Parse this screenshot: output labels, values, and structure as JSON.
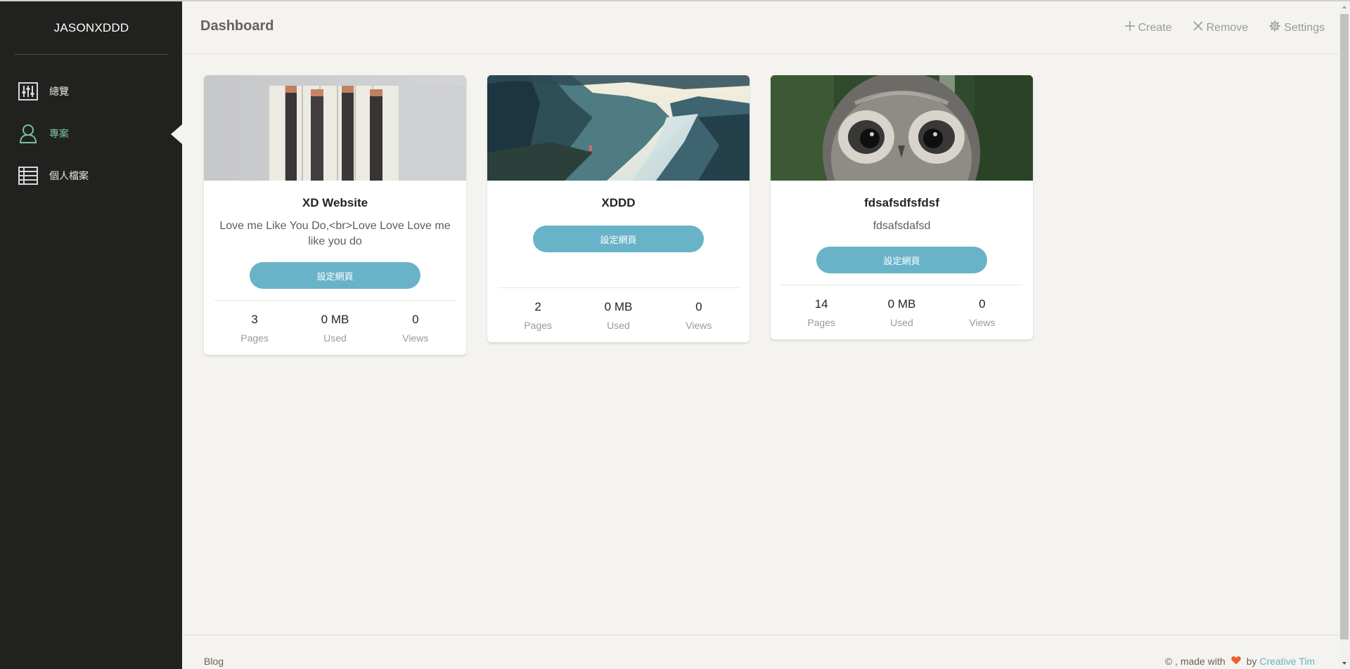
{
  "sidebar": {
    "brand": "JASONXDDD",
    "items": [
      {
        "label": "總覽",
        "icon": "sliders-icon"
      },
      {
        "label": "專案",
        "icon": "user-icon",
        "active": true
      },
      {
        "label": "個人檔案",
        "icon": "list-icon"
      }
    ]
  },
  "header": {
    "title": "Dashboard",
    "actions": {
      "create": "Create",
      "remove": "Remove",
      "settings": "Settings"
    }
  },
  "cards": [
    {
      "title": "XD Website",
      "description": "Love me Like You Do,<br>Love Love Love me like you do",
      "button": "設定網頁",
      "stats": [
        {
          "value": "3",
          "label": "Pages"
        },
        {
          "value": "0 MB",
          "label": "Used"
        },
        {
          "value": "0",
          "label": "Views"
        }
      ]
    },
    {
      "title": "XDDD",
      "description": "",
      "button": "設定網頁",
      "stats": [
        {
          "value": "2",
          "label": "Pages"
        },
        {
          "value": "0 MB",
          "label": "Used"
        },
        {
          "value": "0",
          "label": "Views"
        }
      ]
    },
    {
      "title": "fdsafsdfsfdsf",
      "description": "fdsafsdafsd",
      "button": "設定網頁",
      "stats": [
        {
          "value": "14",
          "label": "Pages"
        },
        {
          "value": "0 MB",
          "label": "Used"
        },
        {
          "value": "0",
          "label": "Views"
        }
      ]
    }
  ],
  "footer": {
    "left_link": "Blog",
    "copyright": "© , made with",
    "by": "by",
    "author": "Creative Tim"
  },
  "colors": {
    "sidebar_bg": "#212120",
    "page_bg": "#f4f3ef",
    "accent_green": "#7ac29a",
    "button_blue": "#68b3c8",
    "heart": "#eb5e28"
  }
}
